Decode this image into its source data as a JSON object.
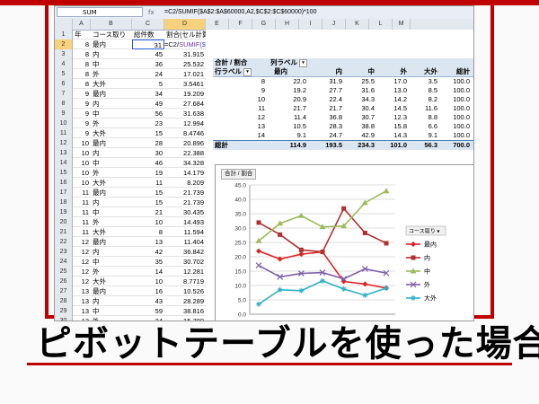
{
  "slide": {
    "title": "ピボットテーブルを使った場合"
  },
  "formula_bar": {
    "name_box": "SUM",
    "fx": "fx",
    "formula": "=C2/SUMIF($A$2:$A$60000,A2,$C$2:$C$60000)*100"
  },
  "columns": [
    "A",
    "B",
    "C",
    "D",
    "E",
    "F",
    "G",
    "H",
    "I",
    "J",
    "K",
    "L",
    "M"
  ],
  "header_row": {
    "a": "年",
    "b": "コース取り",
    "c": "総件数",
    "d": "割合(セル計算)"
  },
  "edit_formula": {
    "p1": "=C2/",
    "p2": "SUMIF(",
    "p3": "$A$2:$A$60000,A2,$C$2:$C$60000)*100"
  },
  "rows": [
    {
      "n": "2",
      "a": "8",
      "b": "最内",
      "c": "31",
      "d": ""
    },
    {
      "n": "3",
      "a": "8",
      "b": "内",
      "c": "45",
      "d": "31.915"
    },
    {
      "n": "4",
      "a": "8",
      "b": "中",
      "c": "36",
      "d": "25.532"
    },
    {
      "n": "5",
      "a": "8",
      "b": "外",
      "c": "24",
      "d": "17.021"
    },
    {
      "n": "6",
      "a": "8",
      "b": "大外",
      "c": "5",
      "d": "3.5461"
    },
    {
      "n": "7",
      "a": "9",
      "b": "最内",
      "c": "34",
      "d": "19.209"
    },
    {
      "n": "8",
      "a": "9",
      "b": "内",
      "c": "49",
      "d": "27.684"
    },
    {
      "n": "9",
      "a": "9",
      "b": "中",
      "c": "56",
      "d": "31.638"
    },
    {
      "n": "10",
      "a": "9",
      "b": "外",
      "c": "23",
      "d": "12.994"
    },
    {
      "n": "11",
      "a": "9",
      "b": "大外",
      "c": "15",
      "d": "8.4746"
    },
    {
      "n": "12",
      "a": "10",
      "b": "最内",
      "c": "28",
      "d": "20.896"
    },
    {
      "n": "13",
      "a": "10",
      "b": "内",
      "c": "30",
      "d": "22.388"
    },
    {
      "n": "14",
      "a": "10",
      "b": "中",
      "c": "46",
      "d": "34.328"
    },
    {
      "n": "15",
      "a": "10",
      "b": "外",
      "c": "19",
      "d": "14.179"
    },
    {
      "n": "16",
      "a": "10",
      "b": "大外",
      "c": "11",
      "d": "8.209"
    },
    {
      "n": "17",
      "a": "11",
      "b": "最内",
      "c": "15",
      "d": "21.739"
    },
    {
      "n": "18",
      "a": "11",
      "b": "内",
      "c": "15",
      "d": "21.739"
    },
    {
      "n": "19",
      "a": "11",
      "b": "中",
      "c": "21",
      "d": "30.435"
    },
    {
      "n": "20",
      "a": "11",
      "b": "外",
      "c": "10",
      "d": "14.493"
    },
    {
      "n": "21",
      "a": "11",
      "b": "大外",
      "c": "8",
      "d": "11.594"
    },
    {
      "n": "22",
      "a": "12",
      "b": "最内",
      "c": "13",
      "d": "11.404"
    },
    {
      "n": "23",
      "a": "12",
      "b": "内",
      "c": "42",
      "d": "36.842"
    },
    {
      "n": "24",
      "a": "12",
      "b": "中",
      "c": "35",
      "d": "30.702"
    },
    {
      "n": "25",
      "a": "12",
      "b": "外",
      "c": "14",
      "d": "12.281"
    },
    {
      "n": "26",
      "a": "12",
      "b": "大外",
      "c": "10",
      "d": "8.7719"
    },
    {
      "n": "27",
      "a": "13",
      "b": "最内",
      "c": "16",
      "d": "10.526"
    },
    {
      "n": "28",
      "a": "13",
      "b": "内",
      "c": "43",
      "d": "28.289"
    },
    {
      "n": "29",
      "a": "13",
      "b": "中",
      "c": "59",
      "d": "38.816"
    },
    {
      "n": "30",
      "a": "13",
      "b": "外",
      "c": "24",
      "d": "15.789"
    },
    {
      "n": "31",
      "a": "13",
      "b": "大外",
      "c": "10",
      "d": "6.5789"
    }
  ],
  "pivot": {
    "label_sum": "合計 / 割合",
    "label_col": "列ラベル",
    "label_row": "行ラベル",
    "cols": [
      "最内",
      "内",
      "中",
      "外",
      "大外",
      "総計"
    ],
    "rows": [
      {
        "k": "8",
        "v": [
          "22.0",
          "31.9",
          "25.5",
          "17.0",
          "3.5",
          "100.0"
        ]
      },
      {
        "k": "9",
        "v": [
          "19.2",
          "27.7",
          "31.6",
          "13.0",
          "8.5",
          "100.0"
        ]
      },
      {
        "k": "10",
        "v": [
          "20.9",
          "22.4",
          "34.3",
          "14.2",
          "8.2",
          "100.0"
        ]
      },
      {
        "k": "11",
        "v": [
          "21.7",
          "21.7",
          "30.4",
          "14.5",
          "11.6",
          "100.0"
        ]
      },
      {
        "k": "12",
        "v": [
          "11.4",
          "36.8",
          "30.7",
          "12.3",
          "8.8",
          "100.0"
        ]
      },
      {
        "k": "13",
        "v": [
          "10.5",
          "28.3",
          "38.8",
          "15.8",
          "6.6",
          "100.0"
        ]
      },
      {
        "k": "14",
        "v": [
          "9.1",
          "24.7",
          "42.9",
          "14.3",
          "9.1",
          "100.0"
        ]
      }
    ],
    "total_label": "総計",
    "total": [
      "114.9",
      "193.5",
      "234.3",
      "101.0",
      "56.3",
      "700.0"
    ]
  },
  "chart_data": {
    "type": "line",
    "button": "合計 / 割合",
    "legend_title": "コース取り",
    "legend_position": "right",
    "ylim": [
      0,
      45
    ],
    "yticks": [
      "0.0",
      "5.0",
      "10.0",
      "15.0",
      "20.0",
      "25.0",
      "30.0",
      "35.0",
      "40.0",
      "45.0"
    ],
    "x": [
      "8",
      "9",
      "10",
      "11",
      "12",
      "13",
      "14"
    ],
    "series": [
      {
        "name": "最内",
        "color": "#e02020",
        "marker": "diamond",
        "values": [
          22.0,
          19.2,
          20.9,
          21.7,
          11.4,
          10.5,
          9.1
        ]
      },
      {
        "name": "内",
        "color": "#b03030",
        "marker": "square",
        "values": [
          31.9,
          27.7,
          22.4,
          21.7,
          36.8,
          28.3,
          24.7
        ]
      },
      {
        "name": "中",
        "color": "#9bbb59",
        "marker": "triangle",
        "values": [
          25.5,
          31.6,
          34.3,
          30.4,
          30.7,
          38.8,
          42.9
        ]
      },
      {
        "name": "外",
        "color": "#7e5fa8",
        "marker": "x",
        "values": [
          17.0,
          13.0,
          14.2,
          14.5,
          12.3,
          15.8,
          14.3
        ]
      },
      {
        "name": "大外",
        "color": "#31b0c8",
        "marker": "star",
        "values": [
          3.5,
          8.5,
          8.2,
          11.6,
          8.8,
          6.6,
          9.1
        ]
      }
    ]
  }
}
